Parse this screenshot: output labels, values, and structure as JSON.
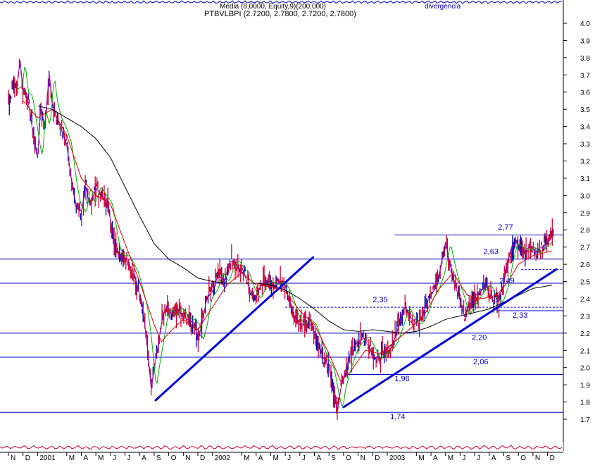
{
  "header": {
    "legend_text": "Media (8,0000, Equity,9)(200,000)",
    "instrument_label": "PTBVLBPI (2.7200, 2.7800, 2.7200, 2.7800)",
    "top_right_label": "divergencia"
  },
  "colors": {
    "price_bar": "#cc0033",
    "candle_alt": "#0000aa",
    "ma_fast": "#8800aa",
    "ma_green": "#00aa00",
    "ma_red": "#dd0000",
    "ma_long": "#000000",
    "levels": "#0000cc",
    "trendlines": "#0000dd",
    "axis_text": "#000000"
  },
  "chart_data": {
    "type": "line",
    "title": "",
    "xlabel": "",
    "ylabel": "",
    "ylim": [
      1.6,
      4.1
    ],
    "y_ticks": [
      1.7,
      1.8,
      1.9,
      2.0,
      2.1,
      2.2,
      2.3,
      2.4,
      2.5,
      2.6,
      2.7,
      2.8,
      2.9,
      3.0,
      3.1,
      3.2,
      3.3,
      3.4,
      3.5,
      3.6,
      3.7,
      3.8,
      3.9,
      4.0
    ],
    "x_ticks": [
      "N",
      "D",
      "2001",
      "M",
      "A",
      "M",
      "J",
      "J",
      "A",
      "S",
      "O",
      "N",
      "D",
      "2002",
      "M",
      "A",
      "M",
      "J",
      "J",
      "A",
      "S",
      "O",
      "N",
      "D",
      "2003",
      "M",
      "A",
      "M",
      "J",
      "J",
      "A",
      "S",
      "O",
      "N",
      "D"
    ],
    "x_tick_month_index": [
      0,
      1,
      2,
      4,
      5,
      6,
      7,
      8,
      9,
      10,
      11,
      12,
      13,
      14,
      16,
      17,
      18,
      19,
      20,
      21,
      22,
      23,
      24,
      25,
      26,
      28,
      29,
      30,
      31,
      32,
      33,
      34,
      35,
      36,
      37
    ],
    "month_range": [
      0,
      37.6
    ],
    "price_anchors": [
      [
        0.0,
        3.55
      ],
      [
        0.3,
        3.62
      ],
      [
        0.6,
        3.63
      ],
      [
        0.8,
        3.78
      ],
      [
        1.0,
        3.6
      ],
      [
        1.3,
        3.58
      ],
      [
        1.6,
        3.42
      ],
      [
        1.8,
        3.3
      ],
      [
        2.0,
        3.22
      ],
      [
        2.2,
        3.5
      ],
      [
        2.5,
        3.4
      ],
      [
        2.8,
        3.7
      ],
      [
        3.0,
        3.55
      ],
      [
        3.3,
        3.45
      ],
      [
        3.6,
        3.4
      ],
      [
        4.0,
        3.3
      ],
      [
        4.3,
        3.1
      ],
      [
        4.6,
        2.95
      ],
      [
        5.0,
        2.9
      ],
      [
        5.3,
        3.05
      ],
      [
        5.6,
        2.95
      ],
      [
        6.0,
        3.05
      ],
      [
        6.4,
        3.0
      ],
      [
        6.8,
        2.95
      ],
      [
        7.0,
        2.85
      ],
      [
        7.3,
        2.7
      ],
      [
        7.6,
        2.65
      ],
      [
        8.0,
        2.65
      ],
      [
        8.3,
        2.6
      ],
      [
        8.6,
        2.55
      ],
      [
        8.9,
        2.45
      ],
      [
        9.2,
        2.35
      ],
      [
        9.5,
        2.15
      ],
      [
        9.8,
        1.88
      ],
      [
        10.0,
        2.0
      ],
      [
        10.3,
        2.15
      ],
      [
        10.6,
        2.3
      ],
      [
        10.9,
        2.35
      ],
      [
        11.2,
        2.3
      ],
      [
        11.6,
        2.35
      ],
      [
        12.0,
        2.3
      ],
      [
        12.4,
        2.28
      ],
      [
        12.8,
        2.25
      ],
      [
        13.0,
        2.15
      ],
      [
        13.3,
        2.25
      ],
      [
        13.6,
        2.4
      ],
      [
        14.0,
        2.45
      ],
      [
        14.4,
        2.55
      ],
      [
        14.8,
        2.5
      ],
      [
        15.2,
        2.6
      ],
      [
        15.5,
        2.62
      ],
      [
        15.8,
        2.58
      ],
      [
        16.2,
        2.55
      ],
      [
        16.6,
        2.45
      ],
      [
        17.0,
        2.4
      ],
      [
        17.4,
        2.48
      ],
      [
        17.8,
        2.5
      ],
      [
        18.2,
        2.48
      ],
      [
        18.6,
        2.5
      ],
      [
        19.0,
        2.45
      ],
      [
        19.3,
        2.38
      ],
      [
        19.6,
        2.3
      ],
      [
        20.0,
        2.25
      ],
      [
        20.4,
        2.28
      ],
      [
        20.8,
        2.25
      ],
      [
        21.2,
        2.15
      ],
      [
        21.6,
        2.05
      ],
      [
        22.0,
        2.0
      ],
      [
        22.4,
        1.82
      ],
      [
        22.6,
        1.76
      ],
      [
        22.8,
        1.88
      ],
      [
        23.2,
        2.0
      ],
      [
        23.6,
        2.1
      ],
      [
        24.0,
        2.15
      ],
      [
        24.4,
        2.18
      ],
      [
        24.8,
        2.12
      ],
      [
        25.2,
        2.05
      ],
      [
        25.6,
        2.08
      ],
      [
        26.0,
        2.1
      ],
      [
        26.4,
        2.15
      ],
      [
        26.8,
        2.25
      ],
      [
        27.2,
        2.35
      ],
      [
        27.6,
        2.28
      ],
      [
        28.0,
        2.25
      ],
      [
        28.4,
        2.3
      ],
      [
        28.8,
        2.4
      ],
      [
        29.2,
        2.45
      ],
      [
        29.6,
        2.55
      ],
      [
        30.0,
        2.72
      ],
      [
        30.3,
        2.6
      ],
      [
        30.6,
        2.5
      ],
      [
        31.0,
        2.4
      ],
      [
        31.3,
        2.3
      ],
      [
        31.6,
        2.35
      ],
      [
        32.0,
        2.4
      ],
      [
        32.4,
        2.45
      ],
      [
        32.8,
        2.48
      ],
      [
        33.2,
        2.4
      ],
      [
        33.6,
        2.38
      ],
      [
        34.0,
        2.48
      ],
      [
        34.3,
        2.62
      ],
      [
        34.6,
        2.72
      ],
      [
        35.0,
        2.7
      ],
      [
        35.4,
        2.68
      ],
      [
        35.8,
        2.7
      ],
      [
        36.2,
        2.66
      ],
      [
        36.6,
        2.7
      ],
      [
        37.0,
        2.73
      ],
      [
        37.4,
        2.78
      ]
    ],
    "ma_long_anchors": [
      [
        2.0,
        3.52
      ],
      [
        3.0,
        3.5
      ],
      [
        4.0,
        3.45
      ],
      [
        5.0,
        3.4
      ],
      [
        6.0,
        3.33
      ],
      [
        7.0,
        3.22
      ],
      [
        8.0,
        3.05
      ],
      [
        9.0,
        2.88
      ],
      [
        10.0,
        2.72
      ],
      [
        11.0,
        2.63
      ],
      [
        12.0,
        2.58
      ],
      [
        13.0,
        2.52
      ],
      [
        14.0,
        2.5
      ],
      [
        15.0,
        2.49
      ],
      [
        16.0,
        2.49
      ],
      [
        17.0,
        2.49
      ],
      [
        18.0,
        2.48
      ],
      [
        19.0,
        2.45
      ],
      [
        20.0,
        2.4
      ],
      [
        21.0,
        2.34
      ],
      [
        22.0,
        2.27
      ],
      [
        23.0,
        2.22
      ],
      [
        24.0,
        2.21
      ],
      [
        25.0,
        2.22
      ],
      [
        26.0,
        2.21
      ],
      [
        27.0,
        2.2
      ],
      [
        28.0,
        2.21
      ],
      [
        29.0,
        2.24
      ],
      [
        30.0,
        2.28
      ],
      [
        31.0,
        2.3
      ],
      [
        32.0,
        2.32
      ],
      [
        33.0,
        2.34
      ],
      [
        34.0,
        2.38
      ],
      [
        35.0,
        2.42
      ],
      [
        36.0,
        2.46
      ],
      [
        37.4,
        2.48
      ]
    ],
    "ma_red_anchors": [
      [
        1.0,
        3.55
      ],
      [
        2.0,
        3.45
      ],
      [
        3.0,
        3.5
      ],
      [
        4.0,
        3.35
      ],
      [
        5.0,
        3.1
      ],
      [
        6.0,
        3.0
      ],
      [
        7.0,
        2.95
      ],
      [
        8.0,
        2.72
      ],
      [
        9.0,
        2.5
      ],
      [
        10.0,
        2.25
      ],
      [
        10.5,
        2.15
      ],
      [
        11.0,
        2.2
      ],
      [
        12.0,
        2.28
      ],
      [
        13.0,
        2.22
      ],
      [
        14.0,
        2.35
      ],
      [
        15.0,
        2.48
      ],
      [
        16.0,
        2.55
      ],
      [
        17.0,
        2.48
      ],
      [
        18.0,
        2.47
      ],
      [
        19.0,
        2.44
      ],
      [
        20.0,
        2.33
      ],
      [
        21.0,
        2.25
      ],
      [
        22.0,
        2.08
      ],
      [
        22.8,
        1.92
      ],
      [
        23.5,
        1.98
      ],
      [
        24.5,
        2.1
      ],
      [
        25.5,
        2.08
      ],
      [
        26.5,
        2.15
      ],
      [
        27.5,
        2.22
      ],
      [
        28.5,
        2.3
      ],
      [
        29.5,
        2.45
      ],
      [
        30.5,
        2.55
      ],
      [
        31.5,
        2.42
      ],
      [
        32.5,
        2.4
      ],
      [
        33.5,
        2.42
      ],
      [
        34.3,
        2.5
      ],
      [
        35.0,
        2.6
      ],
      [
        36.0,
        2.65
      ],
      [
        37.4,
        2.68
      ]
    ],
    "horizontal_levels": [
      {
        "value": 2.77,
        "start_month": 26.5,
        "style": "solid"
      },
      {
        "value": 2.63,
        "start_month": 0,
        "style": "solid"
      },
      {
        "value": 2.49,
        "start_month": 0,
        "style": "solid"
      },
      {
        "value": 2.35,
        "start_month": 19.0,
        "style": "dashed"
      },
      {
        "value": 2.33,
        "start_month": 33.5,
        "style": "solid"
      },
      {
        "value": 2.2,
        "start_month": 0,
        "style": "solid"
      },
      {
        "value": 2.06,
        "start_month": 0,
        "style": "solid"
      },
      {
        "value": 1.96,
        "start_month": 23.2,
        "style": "solid"
      },
      {
        "value": 1.74,
        "start_month": 0,
        "style": "solid"
      },
      {
        "value": 2.57,
        "start_month": 35.2,
        "style": "dashed"
      }
    ],
    "level_labels": [
      {
        "text": "2,77",
        "month": 33.6,
        "value": 2.8
      },
      {
        "text": "2,63",
        "month": 32.6,
        "value": 2.66
      },
      {
        "text": "2,49",
        "month": 33.7,
        "value": 2.49
      },
      {
        "text": "2,35",
        "month": 25.0,
        "value": 2.38
      },
      {
        "text": "2,33",
        "month": 34.6,
        "value": 2.29
      },
      {
        "text": "2,20",
        "month": 31.8,
        "value": 2.16
      },
      {
        "text": "2,06",
        "month": 31.9,
        "value": 2.02
      },
      {
        "text": "1,96",
        "month": 26.5,
        "value": 1.92
      },
      {
        "text": "1,74",
        "month": 26.2,
        "value": 1.7
      }
    ],
    "trendlines": [
      {
        "from": [
          10.1,
          1.81
        ],
        "to": [
          20.9,
          2.64
        ]
      },
      {
        "from": [
          23.0,
          1.77
        ],
        "to": [
          37.6,
          2.57
        ]
      }
    ]
  }
}
